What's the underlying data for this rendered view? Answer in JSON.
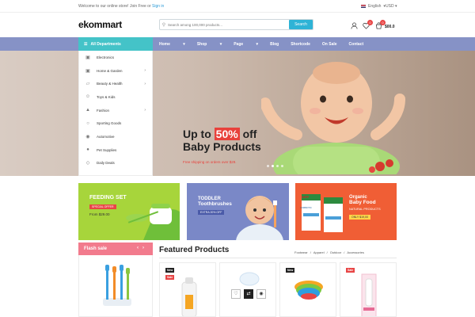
{
  "topbar": {
    "welcome_prefix": "Welcome to our online store! Join Free or",
    "signin": "Sign in",
    "language": "English",
    "currency": "USD"
  },
  "header": {
    "logo": "ekommart",
    "search_placeholder": "Search among 100,000 products...",
    "search_button": "Search",
    "wishlist_count": "0",
    "cart_count": "0",
    "cart_total": "$00.0"
  },
  "nav": {
    "departments": "All Departments",
    "items": [
      "Home",
      "Shop",
      "Page",
      "Blog",
      "Shortcode",
      "On Sale",
      "Contact"
    ]
  },
  "menu": {
    "items": [
      "Electronics",
      "Home & Garden",
      "Beauty & Health",
      "Toys & Kids",
      "Fashion",
      "Sporting Goods",
      "Automotive",
      "Pet Supplies",
      "Daily Deals"
    ]
  },
  "hero": {
    "title_up_to": "Up to",
    "title_pct": "50%",
    "title_off": "off",
    "title_line2": "Baby Products",
    "subtitle": "Free shipping on orders over $29."
  },
  "banners": {
    "b1_title": "FEEDING SET",
    "b1_tag": "SPECIAL OFFER",
    "b1_price": "From $29.00",
    "b2_title1": "TODDLER",
    "b2_title2": "Toothbrushes",
    "b2_tag": "EXTRA 20% OFF",
    "b3_title1": "Organic",
    "b3_title2": "Baby Food",
    "b3_sub": "NATURAL PRODUCTS",
    "b3_tag": "ONLY $19,00",
    "b3_brand": "HiPP",
    "b3_pack": "COMBIOTIC"
  },
  "flash": {
    "title": "Flash sale"
  },
  "featured": {
    "title": "Featured Products",
    "tabs": [
      "Footwear",
      "/",
      "Apparel",
      "/",
      "Outdoor",
      "/",
      "Accessories"
    ],
    "card_tags": [
      "New",
      "Sale",
      "New",
      "Sale"
    ]
  },
  "colors": {
    "teal": "#44c3c8",
    "nav": "#8692c6",
    "accent_red": "#e84545",
    "green_banner": "#a7d53b",
    "blue_banner": "#7a88c7",
    "orange_banner": "#f05e35",
    "flash_pink": "#f27b8d"
  }
}
